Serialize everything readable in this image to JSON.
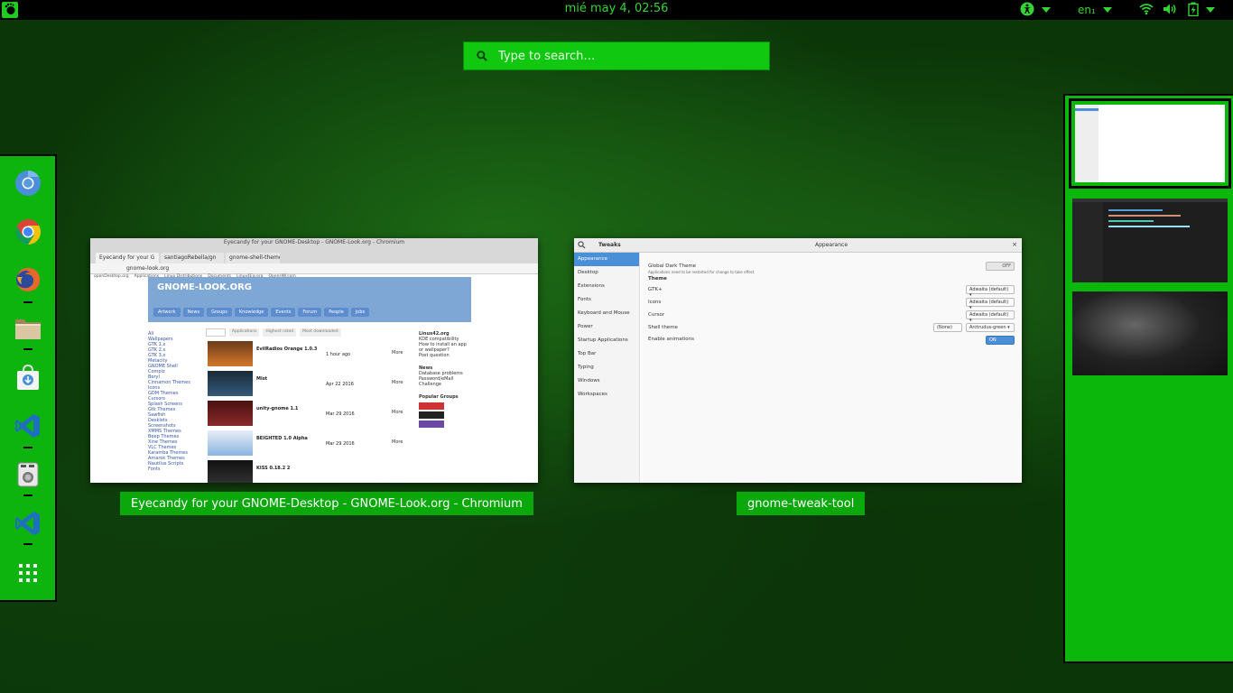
{
  "topbar": {
    "clock": "mié may  4, 02:56",
    "keyboard_layout": "en₁",
    "icons": [
      "gnome-foot-icon",
      "accessibility-icon",
      "wifi-icon",
      "volume-icon",
      "battery-icon"
    ]
  },
  "search": {
    "placeholder": "Type to search…"
  },
  "dash": {
    "apps": [
      {
        "name": "chromium-icon"
      },
      {
        "name": "chrome-icon"
      },
      {
        "name": "firefox-icon"
      },
      {
        "name": "files-icon"
      },
      {
        "name": "software-icon"
      },
      {
        "name": "vscode-icon"
      },
      {
        "name": "settings-panel-icon"
      },
      {
        "name": "vscode-insiders-icon"
      },
      {
        "name": "show-apps-icon"
      }
    ]
  },
  "windows": [
    {
      "label": "Eyecandy for your GNOME-Desktop - GNOME-Look.org - Chromium",
      "title": "Eyecandy for your GNOME-Desktop - GNOME-Look.org - Chromium",
      "tabs": [
        "Eyecandy for your G",
        "santiagoRebella/gn",
        "gnome-shell-theme"
      ],
      "url": "gnome-look.org",
      "bookmarks": [
        "openDesktop.org",
        "Applications",
        "Linux Distributions",
        "Documents",
        "Linux4Eq.org",
        "OpenHW.com"
      ],
      "page": {
        "logo": "GNOME-LOOK.ORG",
        "nav": [
          "Artwork",
          "News",
          "Groups",
          "Knowledge",
          "Events",
          "Forum",
          "People",
          "Jobs"
        ],
        "categories": [
          "All",
          "Wallpapers",
          "GTK 1.x",
          "GTK 2.x",
          "GTK 3.x",
          "Metacity",
          "GNOME Shell",
          "Compiz",
          "Beryl",
          "Cinnamon Themes",
          "Icons",
          "GDM Themes",
          "Cursors",
          "Splash Screens",
          "Gtk Themes",
          "Sawfish",
          "Desklets",
          "Screenshots",
          "XMMS Themes",
          "Beep Themes",
          "Xine Themes",
          "VLC Themes",
          "Karamba Themes",
          "Amarok Themes",
          "Nautilus Scripts",
          "Fonts"
        ],
        "sort_tabs": [
          "Latest",
          "Applications",
          "Highest rated",
          "Most downloaded"
        ],
        "items": [
          {
            "name": "EvilRadios Orange 1.0.3",
            "date": "1 hour ago",
            "more": "More"
          },
          {
            "name": "Mist",
            "date": "Apr 22 2016",
            "more": "More"
          },
          {
            "name": "unity-gnome 1.1",
            "date": "Mar 29 2016",
            "more": "More"
          },
          {
            "name": "BEIGHTED 1.0 Alpha",
            "date": "Mar 29 2016",
            "more": "More"
          },
          {
            "name": "KISS 0.18.2 2",
            "date": "",
            "more": ""
          }
        ],
        "sidebar_right": [
          "Linux42.org",
          "KDE compatibility",
          "How to install an app or wallpaper?",
          "Post question",
          "News",
          "Database problems",
          "Password/eMail",
          "Challenge",
          "Popular Groups"
        ]
      }
    },
    {
      "label": "gnome-tweak-tool",
      "app_name": "Tweaks",
      "section_title": "Appearance",
      "sidebar": [
        "Appearance",
        "Desktop",
        "Extensions",
        "Fonts",
        "Keyboard and Mouse",
        "Power",
        "Startup Applications",
        "Top Bar",
        "Typing",
        "Windows",
        "Workspaces"
      ],
      "settings": {
        "global_dark_theme": "Global Dark Theme",
        "global_dark_note": "Applications need to be restarted for change to take effect",
        "global_dark_value": "OFF",
        "theme_heading": "Theme",
        "gtk_label": "GTK+",
        "gtk_value": "Adwaita (default)",
        "icons_label": "Icons",
        "icons_value": "Adwaita (default)",
        "cursor_label": "Cursor",
        "cursor_value": "Adwaita (default)",
        "shell_label": "Shell theme",
        "shell_none": "(None)",
        "shell_value": "Arctrudus-green",
        "animations_label": "Enable animations",
        "animations_value": "ON"
      }
    }
  ],
  "colors": {
    "accent": "#0fc40f",
    "panel": "#000000",
    "dash_bg": "#0db40d",
    "label_bg": "#0aa80a"
  }
}
